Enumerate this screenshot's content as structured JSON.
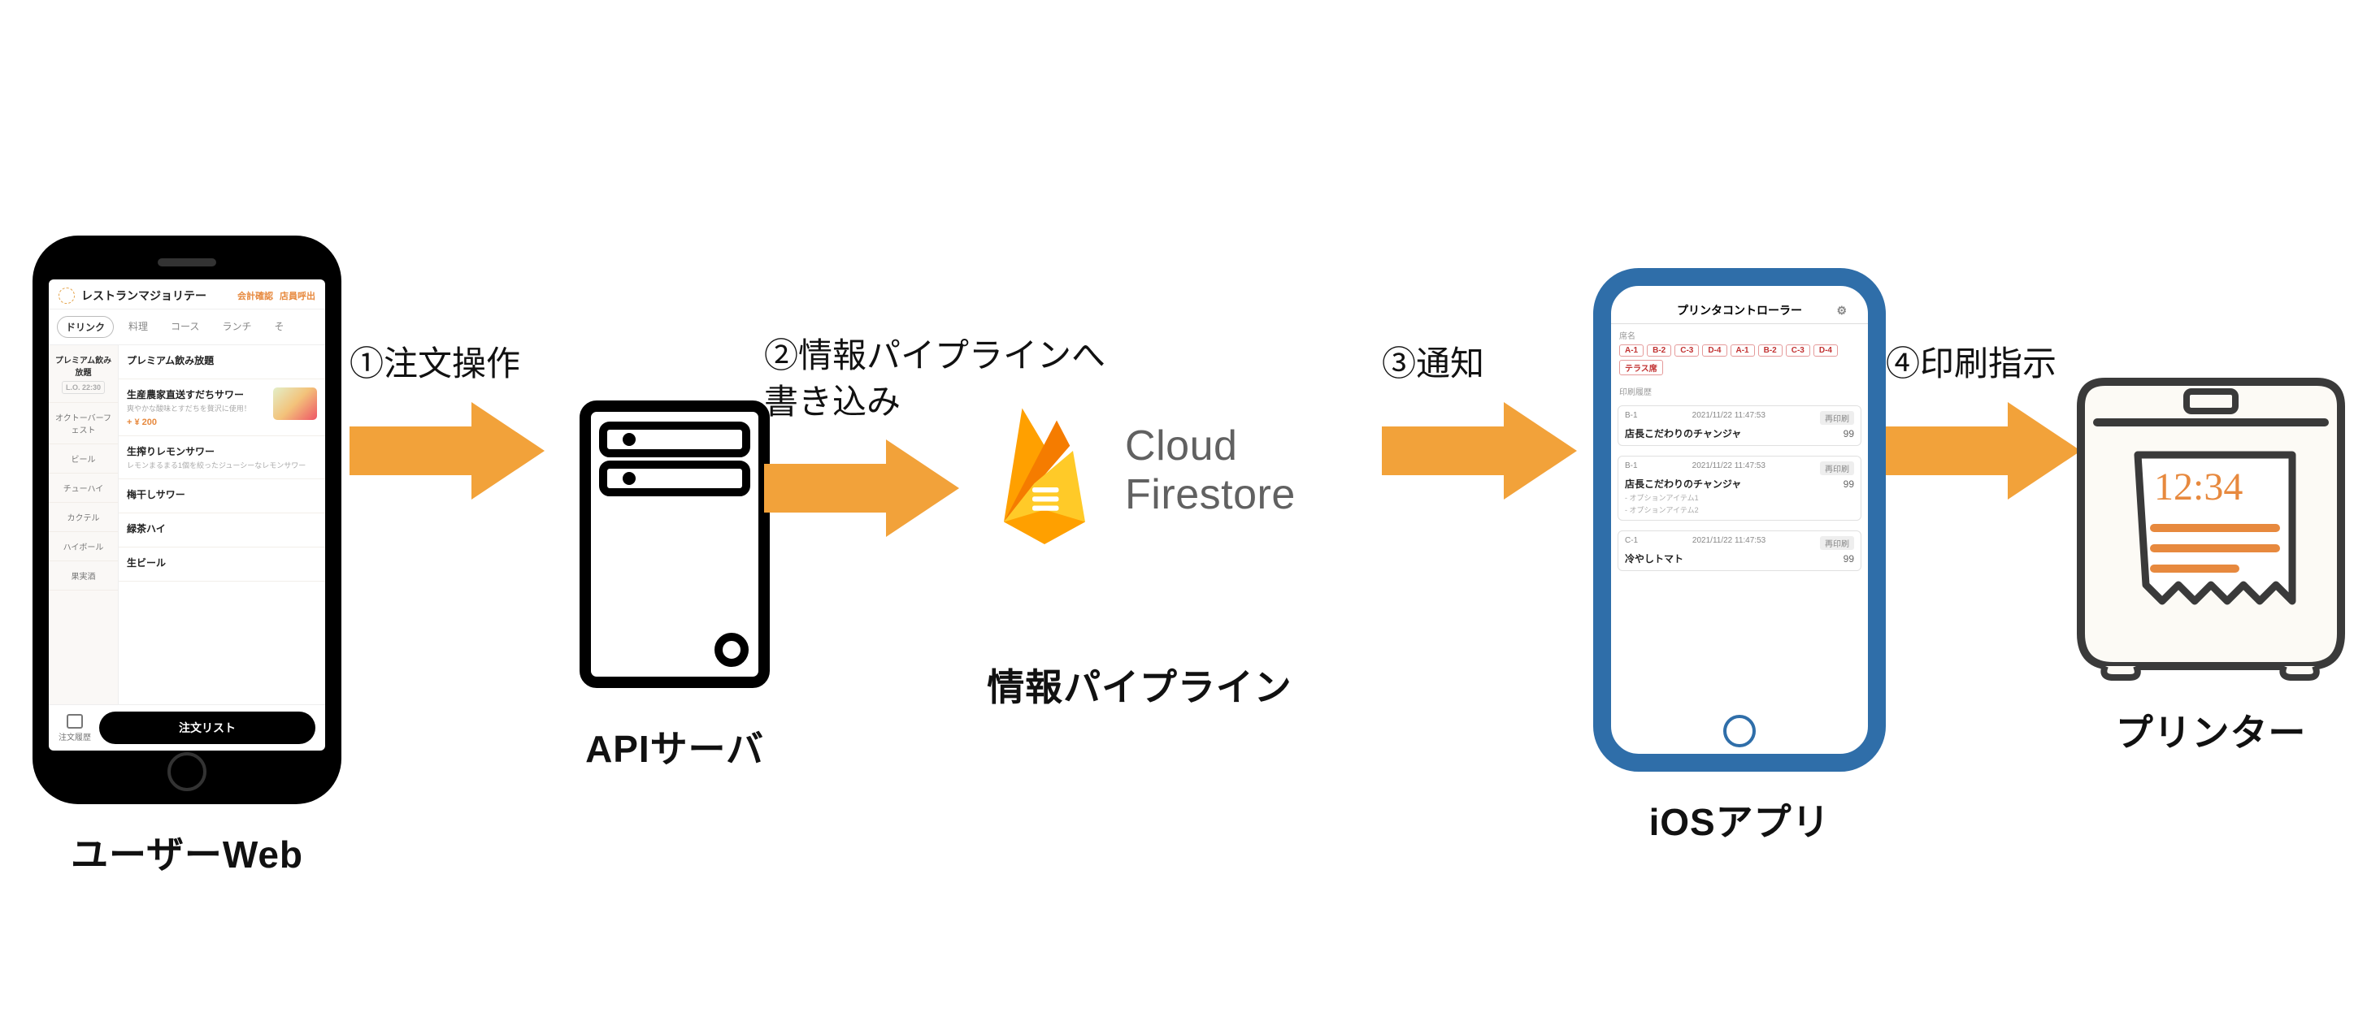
{
  "nodes": {
    "user_web": {
      "caption": "ユーザーWeb"
    },
    "api_server": {
      "caption": "APIサーバ"
    },
    "pipeline": {
      "caption": "情報パイプライン"
    },
    "ios_app": {
      "caption": "iOSアプリ"
    },
    "printer": {
      "caption": "プリンター"
    }
  },
  "arrows": {
    "a1": {
      "label": "①注文操作"
    },
    "a2": {
      "label": "②情報パイプラインへ\n書き込み"
    },
    "a3": {
      "label": "③通知"
    },
    "a4": {
      "label": "④印刷指示"
    }
  },
  "firestore": {
    "line1": "Cloud",
    "line2": "Firestore"
  },
  "user_web_screen": {
    "header": {
      "title": "レストランマジョリテー",
      "link1": "会計確認",
      "link2": "店員呼出"
    },
    "tabs": [
      "ドリンク",
      "料理",
      "コース",
      "ランチ",
      "そ"
    ],
    "active_tab_index": 0,
    "sidebar": {
      "top_cat": "プレミアム飲み放題",
      "lo_badge": "L.O. 22:30",
      "cats": [
        "オクトーバーフェスト",
        "ビール",
        "チューハイ",
        "カクテル",
        "ハイボール",
        "果実酒"
      ]
    },
    "items": [
      {
        "name": "プレミアム飲み放題",
        "desc": "",
        "price": ""
      },
      {
        "name": "生産農家直送すだちサワー",
        "desc": "爽やかな酸味とすだちを贅沢に使用！",
        "price": "+ ¥ 200",
        "has_thumb": true
      },
      {
        "name": "生搾りレモンサワー",
        "desc": "レモンまるまる1個を絞ったジューシーなレモンサワー",
        "price": ""
      },
      {
        "name": "梅干しサワー",
        "desc": "",
        "price": ""
      },
      {
        "name": "緑茶ハイ",
        "desc": "",
        "price": ""
      },
      {
        "name": "生ビール",
        "desc": "",
        "price": ""
      }
    ],
    "footer": {
      "history": "注文履歴",
      "button": "注文リスト"
    }
  },
  "ios_screen": {
    "title": "プリンタコントローラー",
    "tables_label": "席名",
    "tables": [
      "A-1",
      "B-2",
      "C-3",
      "D-4",
      "A-1",
      "B-2",
      "C-3",
      "D-4",
      "テラス席"
    ],
    "history_label": "印刷履歴",
    "reprint_label": "再印刷",
    "cards": [
      {
        "seat": "B-1",
        "ts": "2021/11/22 11:47:53",
        "name": "店長こだわりのチャンジャ",
        "qty": "99",
        "opts": []
      },
      {
        "seat": "B-1",
        "ts": "2021/11/22 11:47:53",
        "name": "店長こだわりのチャンジャ",
        "qty": "99",
        "opts": [
          "- オプションアイテム1",
          "- オプションアイテム2"
        ]
      },
      {
        "seat": "C-1",
        "ts": "2021/11/22 11:47:53",
        "name": "冷やしトマト",
        "qty": "99",
        "opts": []
      }
    ]
  },
  "printer_ticket": {
    "time": "12:34"
  },
  "colors": {
    "arrow": "#f2a23a",
    "ios_frame": "#2f6ea9",
    "firebase_yellow": "#ffca28",
    "firebase_amber": "#ffa000",
    "firebase_orange": "#f57c00",
    "chip_text": "#c23333"
  }
}
